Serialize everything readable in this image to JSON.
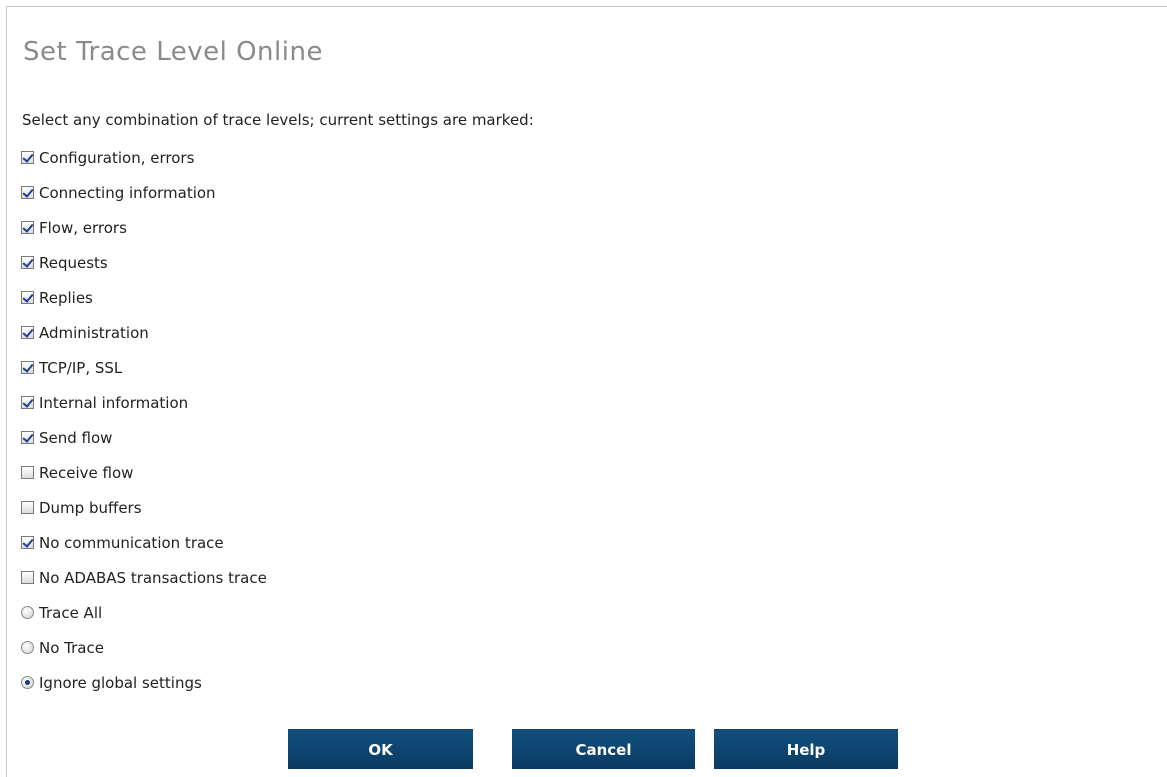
{
  "dialog": {
    "title": "Set Trace Level Online",
    "instructions": "Select any combination of trace levels; current settings are marked:"
  },
  "checkboxes": [
    {
      "label": "Configuration, errors",
      "checked": true
    },
    {
      "label": "Connecting information",
      "checked": true
    },
    {
      "label": "Flow, errors",
      "checked": true
    },
    {
      "label": "Requests",
      "checked": true
    },
    {
      "label": "Replies",
      "checked": true
    },
    {
      "label": "Administration",
      "checked": true
    },
    {
      "label": "TCP/IP, SSL",
      "checked": true
    },
    {
      "label": "Internal information",
      "checked": true
    },
    {
      "label": "Send flow",
      "checked": true
    },
    {
      "label": "Receive flow",
      "checked": false
    },
    {
      "label": "Dump buffers",
      "checked": false
    },
    {
      "label": "No communication trace",
      "checked": true
    },
    {
      "label": "No ADABAS transactions trace",
      "checked": false
    }
  ],
  "radios": [
    {
      "label": "Trace All",
      "selected": false
    },
    {
      "label": "No Trace",
      "selected": false
    },
    {
      "label": "Ignore global settings",
      "selected": true
    }
  ],
  "buttons": {
    "ok": "OK",
    "cancel": "Cancel",
    "help": "Help"
  },
  "colors": {
    "button_bg": "#0d4470",
    "title_text": "#8a8a8a",
    "check_mark": "#1f3f8f"
  }
}
